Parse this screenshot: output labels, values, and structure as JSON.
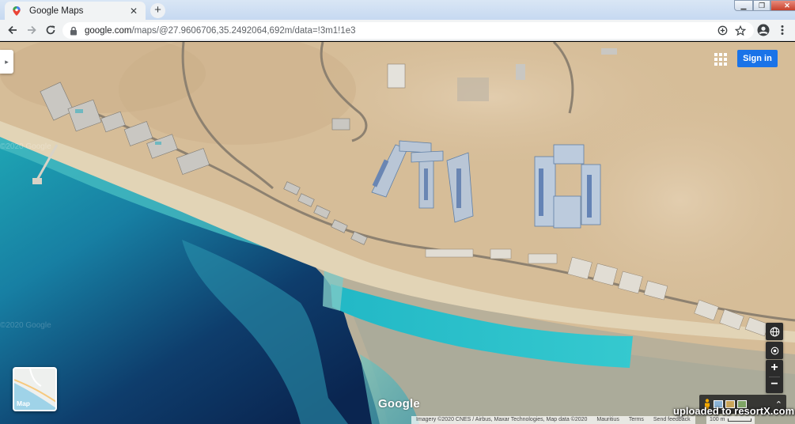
{
  "browser": {
    "tab": {
      "title": "Google Maps",
      "close_glyph": "✕",
      "icon": "google-maps-pin-icon"
    },
    "new_tab_glyph": "+",
    "window_controls": {
      "minimize": "▁",
      "maximize": "❐",
      "close": "✕"
    },
    "address_bar": {
      "domain": "google.com",
      "path": "/maps/@27.9606706,35.2492064,692m/data=!3m1!1e3"
    },
    "icons": [
      "back-arrow-icon",
      "forward-arrow-icon",
      "reload-icon",
      "lock-icon",
      "add-icon",
      "star-icon",
      "profile-icon",
      "menu-dots-icon"
    ]
  },
  "map": {
    "side_toggle_glyph": "▸",
    "signin_label": "Sign in",
    "layer_tile_label": "Map",
    "google_logo": "Google",
    "zoom_in": "+",
    "zoom_out": "−",
    "imagery_chevron": "⌃",
    "attribution": {
      "imagery": "Imagery ©2020 CNES / Airbus, Maxar Technologies, Map data ©2020",
      "country": "Mauritius",
      "terms": "Terms",
      "feedback": "Send feedback",
      "scale": "100 m"
    },
    "watermark": "uploaded to resortX.com",
    "faint_watermarks": [
      "©2020 Google",
      "©2020 Google"
    ]
  },
  "colors": {
    "sign_in_blue": "#1a73e8",
    "deep_sea": "#0d2f5a",
    "lagoon": "#2fb5c2",
    "sand": "#d7bf9c"
  }
}
